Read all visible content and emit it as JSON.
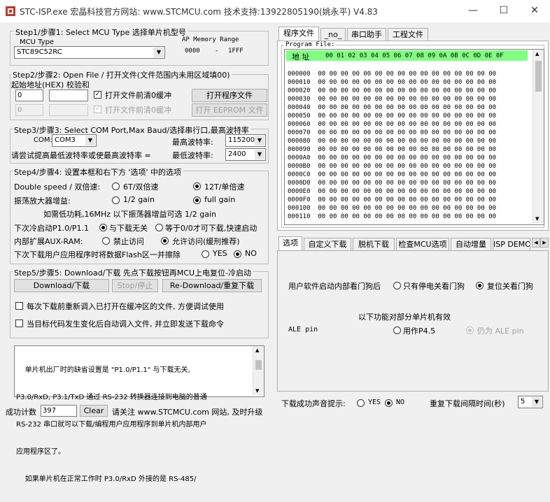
{
  "window": {
    "title": "STC-ISP.exe    宏晶科技官方网站: www.STCMCU.com   技术支持:13922805190(姚永平)   V4.83"
  },
  "step1": {
    "title": "Step1/步骤1: Select MCU Type  选择单片机型号",
    "mcu_type_label": "MCU Type",
    "mcu_value": "STC89C52RC",
    "ap_label": "AP Memory Range",
    "ap_start": "0000",
    "ap_dash": "-",
    "ap_end": "1FFF"
  },
  "step2": {
    "title": "Step2/步骤2: Open File / 打开文件(文件范围内未用区域填00)",
    "start_addr_label": "起始地址(HEX) 校验和",
    "addr1": "0",
    "addr2": "0",
    "clear_buffer1": "打开文件前清0缓冲",
    "clear_buffer2": "打开文件前清0缓冲",
    "open_program_btn": "打开程序文件",
    "open_eeprom_btn": "打开 EEPROM 文件"
  },
  "step3": {
    "title": "Step3/步骤3: Select COM Port,Max Baud/选择串行口,最高波特率",
    "com_label": "COM:",
    "com_value": "COM3",
    "max_baud_label": "最高波特率:",
    "max_baud_value": "115200",
    "min_baud_label": "最低波特率:",
    "min_baud_value": "2400",
    "hint": "请尝试提高最低波特率或使最高波特率 ="
  },
  "step4": {
    "title": "Step4/步骤4: 设置本框和右下方 '选项' 中的选项",
    "double_speed_label": "Double speed / 双倍速:",
    "opt_6t": "6T/双倍速",
    "opt_12t": "12T/单倍速",
    "osc_label": "振荡放大器增益:",
    "opt_half_gain": "1/2 gain",
    "opt_full_gain": "full gain",
    "low_power_note": "如需低功耗,16MHz 以下振荡器增益可选 1/2 gain",
    "cold_start_label": "下次冷启动P1.0/P1.1",
    "opt_no_relation": "与下载无关",
    "opt_equal_zero": "等于0/0才可下载,快速启动",
    "aux_ram_label": "内部扩展AUX-RAM:",
    "opt_forbid": "禁止访问",
    "opt_allow": "允许访问(缓刑推荐)",
    "erase_flash_label": "下次下载用户应用程序时将数据Flash区一并擦除",
    "opt_yes": "YES",
    "opt_no": "NO"
  },
  "step5": {
    "title": "Step5/步骤5: Download/下载   先点下载按钮再MCU上电复位-冷启动",
    "download_btn": "Download/下载",
    "stop_btn": "Stop/停止",
    "redownload_btn": "Re-Download/重复下载",
    "reload_opt": "每次下载前重新调入已打开在缓冲区的文件, 方便调试使用",
    "auto_send_opt": "当目标代码发生变化后自动调入文件, 并立即发送下载命令"
  },
  "info_box": {
    "lines": [
      "    单片机出厂时的缺省设置是 \"P1.0/P1.1\" 与下载无关,",
      "P3.0/RxD, P3.1/TxD 通过 RS-232 转换器连接到电脑的普通",
      "RS-232 串口就可以下载/编程用户应用程序到单片机内部用户",
      "应用程序区了。",
      "    如果单片机在正常工作时 P3.0/RxD 外接的是 RS-485/"
    ]
  },
  "status": {
    "success_label": "成功计数",
    "success_count": "397",
    "clear_btn": "Clear",
    "follow_text": "请关注 www.STCMCU.com 网站, 及时升级"
  },
  "right_tabs": [
    "程序文件",
    "_no_",
    "串口助手",
    "工程文件"
  ],
  "program_file": {
    "label": "Program File:",
    "addr_header": "地 址",
    "col_headers": "00 01 02 03 04 05 06 07 08 09 0A 0B 0C 0D 0E 0F",
    "addresses": [
      "000000",
      "000010",
      "000020",
      "000030",
      "000040",
      "000050",
      "000060",
      "000070",
      "000080",
      "000090",
      "0000A0",
      "0000B0",
      "0000C0",
      "0000D0",
      "0000E0",
      "0000F0",
      "000100",
      "000110"
    ],
    "row_data": "00 00 00 00 00 00 00 00 00 00 00 00 00 00 00 00"
  },
  "option_tabs": [
    "选项",
    "自定义下载",
    "脱机下载",
    "检查MCU选项",
    "自动增量",
    "ISP DEMO"
  ],
  "options": {
    "watchdog_label": "用户软件启动内部看门狗后",
    "opt_power_off_only": "只有停电关看门狗",
    "opt_reset_off": "复位关看门狗",
    "section_title": "以下功能对部分单片机有效",
    "ale_label": "ALE pin",
    "opt_p45": "用作P4.5",
    "opt_still_ale": "仍为 ALE pin"
  },
  "bottom": {
    "sound_label": "下载成功声音提示:",
    "opt_yes": "YES",
    "opt_no": "NO",
    "interval_label": "重复下载间隔时间(秒)",
    "interval_value": "5"
  }
}
